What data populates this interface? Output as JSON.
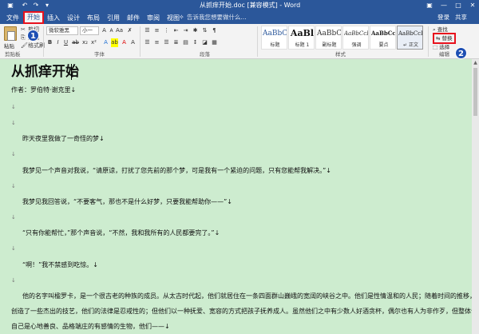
{
  "titlebar": {
    "title": "从抓痒开始.doc [兼容模式] - Word",
    "icons": [
      "save-icon",
      "undo-icon",
      "redo-icon",
      "customize-icon"
    ],
    "window_buttons": [
      "—",
      "□",
      "✕"
    ],
    "ribbon_options": "▣"
  },
  "tabs": [
    {
      "label": "文件",
      "active": false
    },
    {
      "label": "开始",
      "active": true
    },
    {
      "label": "插入",
      "active": false
    },
    {
      "label": "设计",
      "active": false
    },
    {
      "label": "布局",
      "active": false
    },
    {
      "label": "引用",
      "active": false
    },
    {
      "label": "邮件",
      "active": false
    },
    {
      "label": "审阅",
      "active": false
    },
    {
      "label": "视图",
      "active": false
    }
  ],
  "tellme": "告诉我您想要做什么...",
  "account": {
    "login": "登录",
    "share": "共享"
  },
  "ribbon": {
    "clipboard": {
      "paste": "粘贴",
      "cut": "剪切",
      "copy": "复制",
      "format_painter": "格式刷",
      "label": "剪贴板"
    },
    "font": {
      "name": "微软雅黑",
      "size": "小一",
      "label": "字体"
    },
    "paragraph": {
      "label": "段落"
    },
    "styles": {
      "label": "样式",
      "items": [
        {
          "sample": "AaBbC",
          "name": "标题"
        },
        {
          "sample": "AaBl",
          "name": "标题 1"
        },
        {
          "sample": "AaBbC",
          "name": "副标题"
        },
        {
          "sample": "AaBbCcD",
          "name": "强调"
        },
        {
          "sample": "AaBbCcD",
          "name": "要点"
        },
        {
          "sample": "AaBbCcDc",
          "name": "↵ 正文"
        }
      ]
    },
    "editing": {
      "find": "查找",
      "replace": "替换",
      "select": "选择",
      "label": "编辑"
    }
  },
  "badges": [
    "1",
    "2"
  ],
  "document": {
    "title": "从抓痒开始",
    "lines": [
      "作者：罗伯特·谢克里↓",
      "↓",
      "↓",
      "昨天夜里我做了一奇怪的梦↓",
      "↓",
      "我梦见一个声音对我说，“请原谅，打扰了您先前的那个梦，可是我有一个紧迫的问题，只有您能帮我解决。”↓",
      "↓",
      "我梦见我回答说，“不要客气，那也不是什么好梦，只要我能帮助你——”↓",
      "↓",
      "“只有你能帮忙，”那个声音说，“不然，我和我所有的人民都要完了。”↓",
      "↓",
      "“啊！”我不禁感到吃惊。↓",
      "↓",
      "他的名字叫楹罗卡，是一个很古老的种族的成员。从太古时代起，他们就居住在一条四面群山巍峨的宽阔的峡谷之中。他们是性情温和的人民；随着时间的推移，他们",
      "创造了一些杰出的技艺，他们的法律是忍戒性的；但他们以一种抚爱、宽容的方式把孩子抚养成人。虽然他们之中有少数人好酒贪杯，偶尔也有人为非作歹，但整体说认为",
      "自己是心地善良、品格端庄的有感情的生物，他们——↓"
    ]
  }
}
